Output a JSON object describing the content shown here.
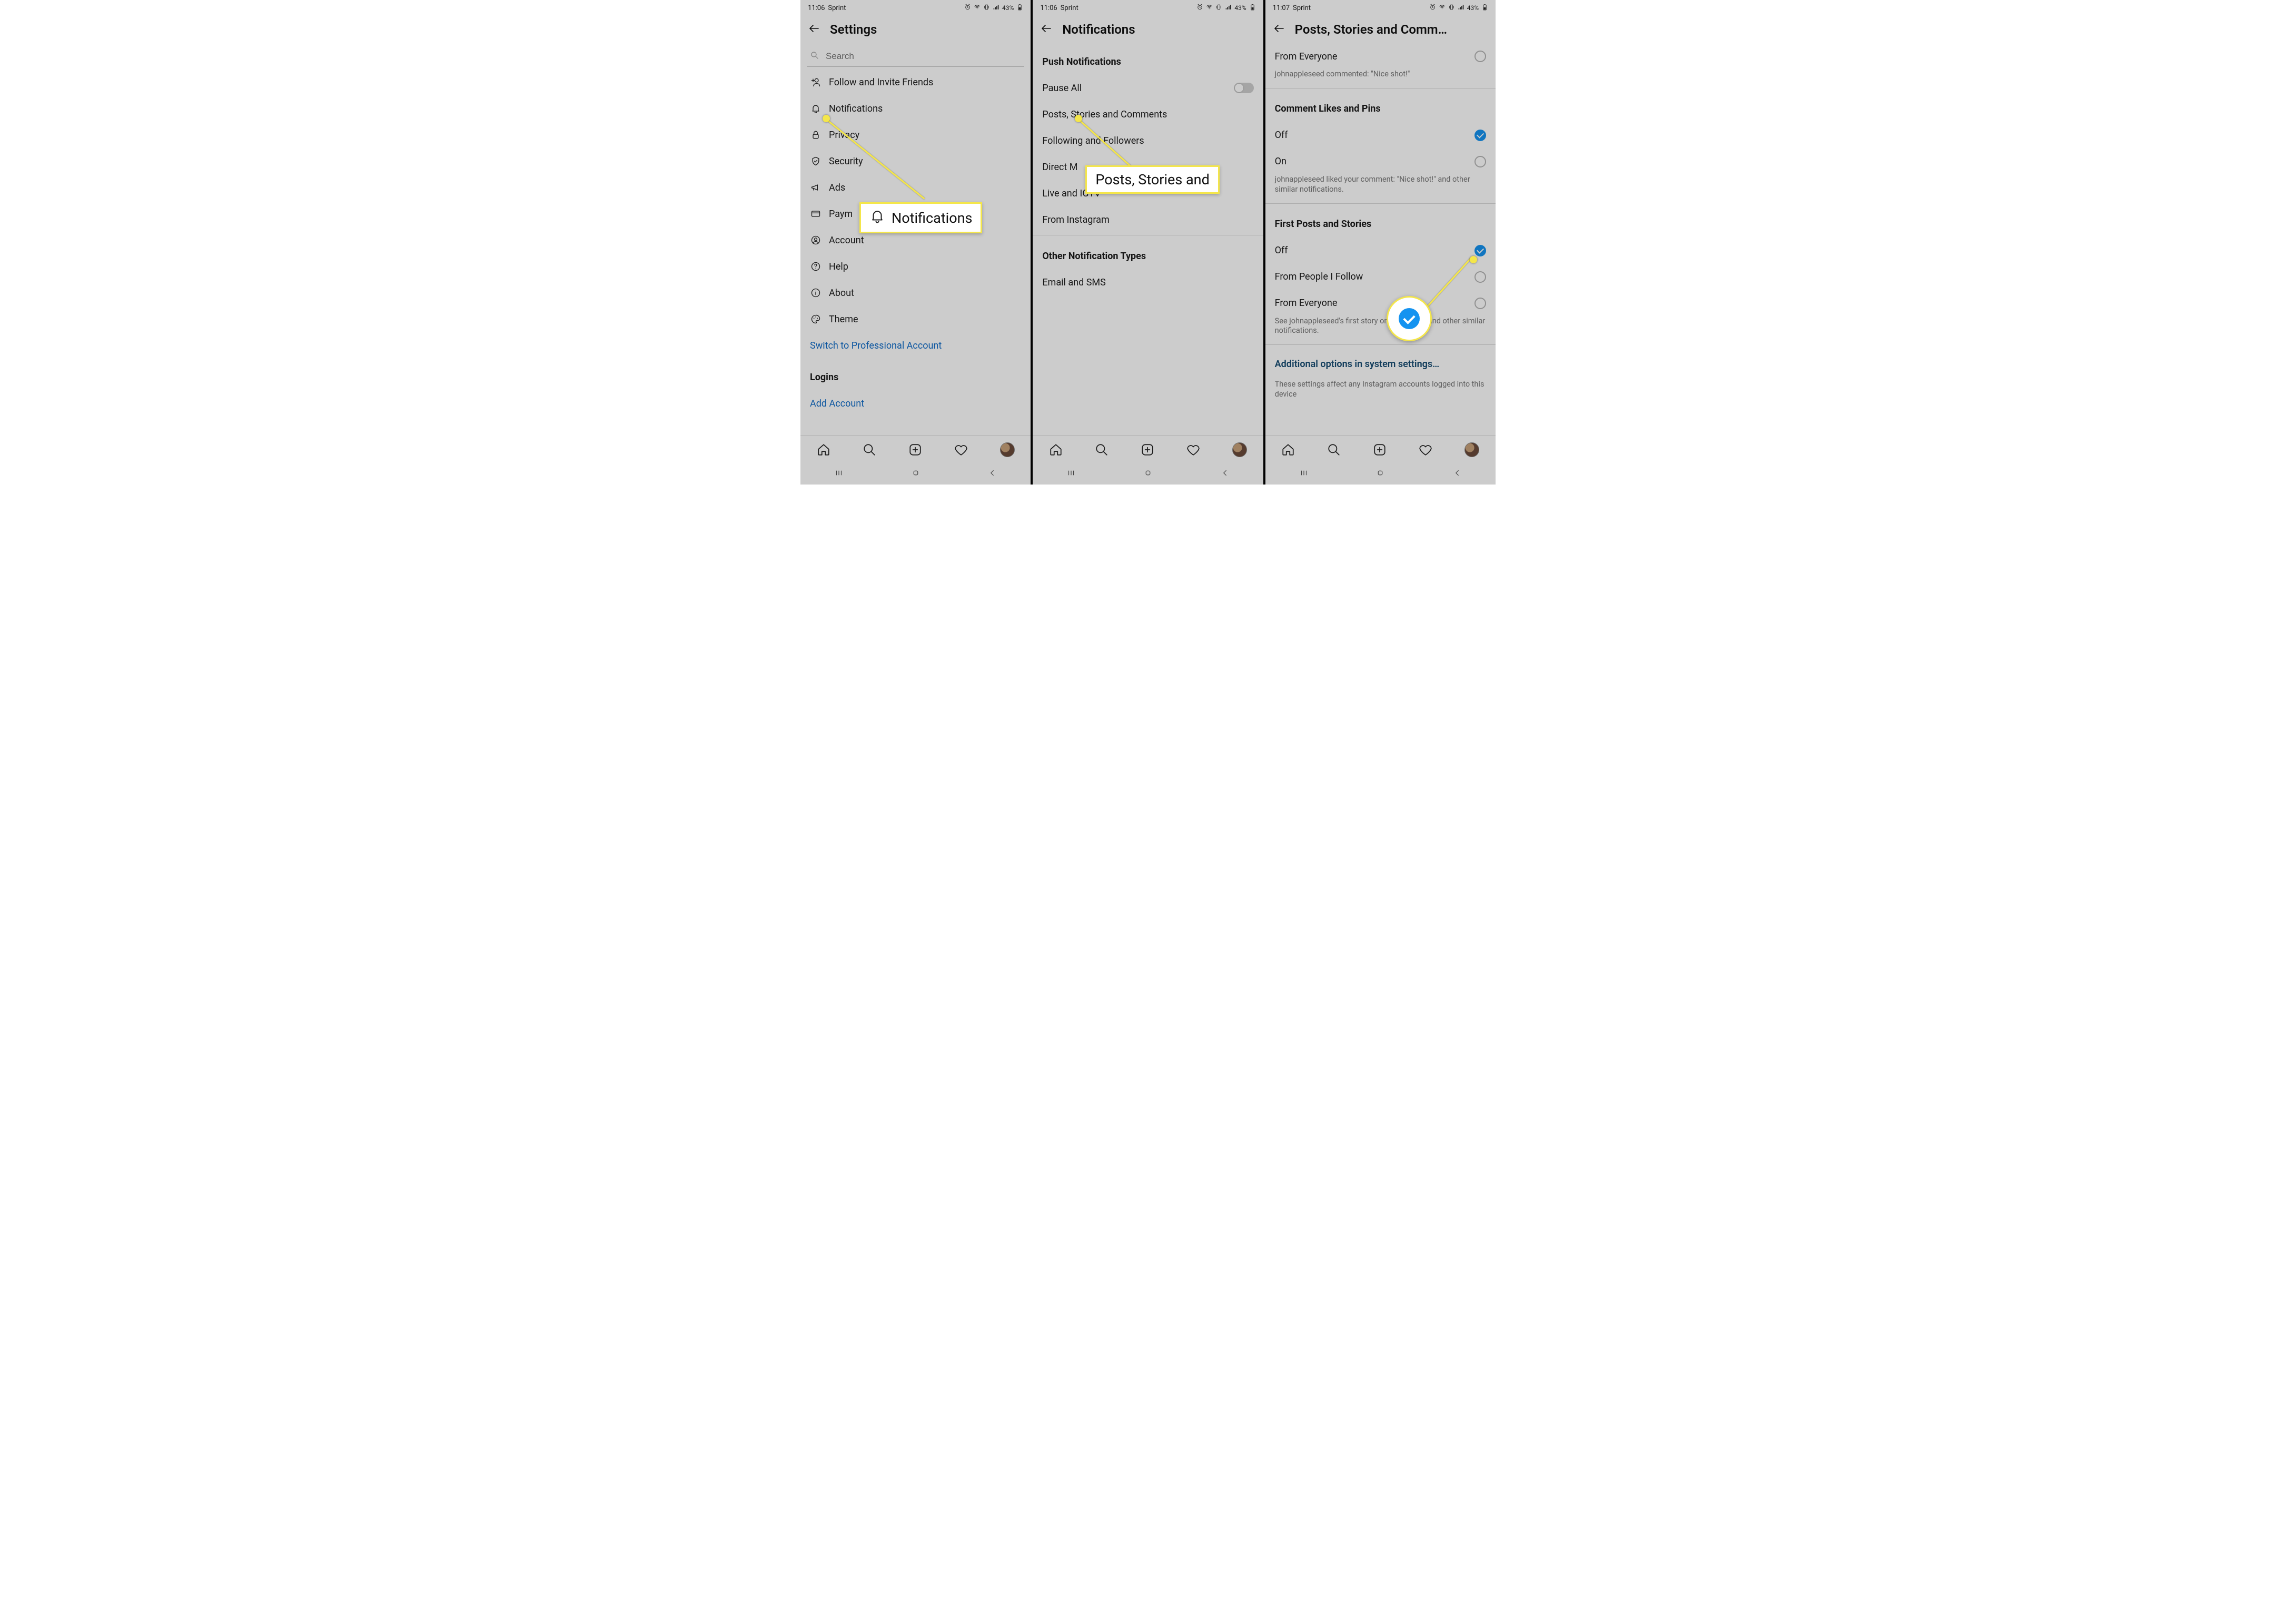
{
  "status": {
    "time1": "11:06",
    "time2": "11:06",
    "time3": "11:07",
    "carrier": "Sprint",
    "battery": "43%"
  },
  "screen1": {
    "title": "Settings",
    "search_placeholder": "Search",
    "items": {
      "follow": "Follow and Invite Friends",
      "notifications": "Notifications",
      "privacy": "Privacy",
      "security": "Security",
      "ads": "Ads",
      "payments": "Paym",
      "account": "Account",
      "help": "Help",
      "about": "About",
      "theme": "Theme"
    },
    "switch_pro": "Switch to Professional Account",
    "logins_header": "Logins",
    "add_account": "Add Account"
  },
  "screen2": {
    "title": "Notifications",
    "push_header": "Push Notifications",
    "pause_all": "Pause All",
    "posts_stories": "Posts, Stories and Comments",
    "following": "Following and Followers",
    "direct": "Direct M",
    "live": "Live and IGTV",
    "from_ig": "From Instagram",
    "other_header": "Other Notification Types",
    "email_sms": "Email and SMS"
  },
  "screen3": {
    "title": "Posts, Stories and Comm…",
    "from_everyone": "From Everyone",
    "example1": "johnappleseed commented: \"Nice shot!\"",
    "clp_header": "Comment Likes and Pins",
    "off": "Off",
    "on": "On",
    "example2": "johnappleseed liked your comment: \"Nice shot!\" and other similar notifications.",
    "fps_header": "First Posts and Stories",
    "from_people": "From People I Follow",
    "example3": "See johnappleseed's first story on Instagram, and other similar notifications.",
    "additional": "Additional options in system settings…",
    "additional_sub": "These settings affect any Instagram accounts logged into this device"
  },
  "callouts": {
    "notifications_label": "Notifications",
    "posts_stories_label": "Posts, Stories and"
  }
}
